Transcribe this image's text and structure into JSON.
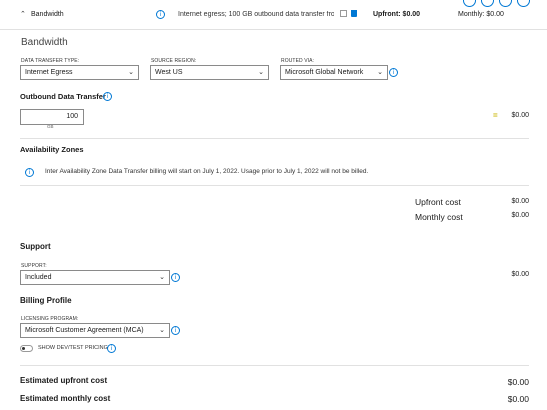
{
  "header": {
    "title": "Bandwidth",
    "summary": "Internet egress; 100 GB outbound data transfer fro...",
    "upfront": "Upfront: $0.00",
    "monthly": "Monthly: $0.00"
  },
  "section_title": "Bandwidth",
  "data_transfer_type": {
    "label": "DATA TRANSFER TYPE:",
    "value": "Internet Egress"
  },
  "source_region": {
    "label": "SOURCE REGION:",
    "value": "West US"
  },
  "routed_via": {
    "label": "ROUTED VIA:",
    "value": "Microsoft Global Network"
  },
  "outbound": {
    "title": "Outbound Data Transfer",
    "value": "100",
    "unit": "GB",
    "equals": "=",
    "cost": "$0.00"
  },
  "availability_zones": {
    "title": "Availability Zones",
    "notice": "Inter Availability Zone Data Transfer billing will start on July 1, 2022. Usage prior to July 1, 2022 will not be billed."
  },
  "costs": {
    "upfront_label": "Upfront cost",
    "upfront_value": "$0.00",
    "monthly_label": "Monthly cost",
    "monthly_value": "$0.00"
  },
  "support": {
    "title": "Support",
    "label": "SUPPORT:",
    "value": "Included",
    "cost": "$0.00"
  },
  "billing": {
    "title": "Billing Profile",
    "label": "LICENSING PROGRAM:",
    "value": "Microsoft Customer Agreement (MCA)",
    "toggle_label": "SHOW DEV/TEST PRICING"
  },
  "estimates": {
    "upfront_label": "Estimated upfront cost",
    "upfront_value": "$0.00",
    "monthly_label": "Estimated monthly cost",
    "monthly_value": "$0.00"
  },
  "colors": {
    "accent": "#0078d4",
    "delete": "#0078d4",
    "equals": "#c8b400"
  },
  "icons": [
    "chevron-up-icon",
    "info-icon",
    "clone-icon",
    "delete-icon",
    "chevron-down-icon"
  ]
}
